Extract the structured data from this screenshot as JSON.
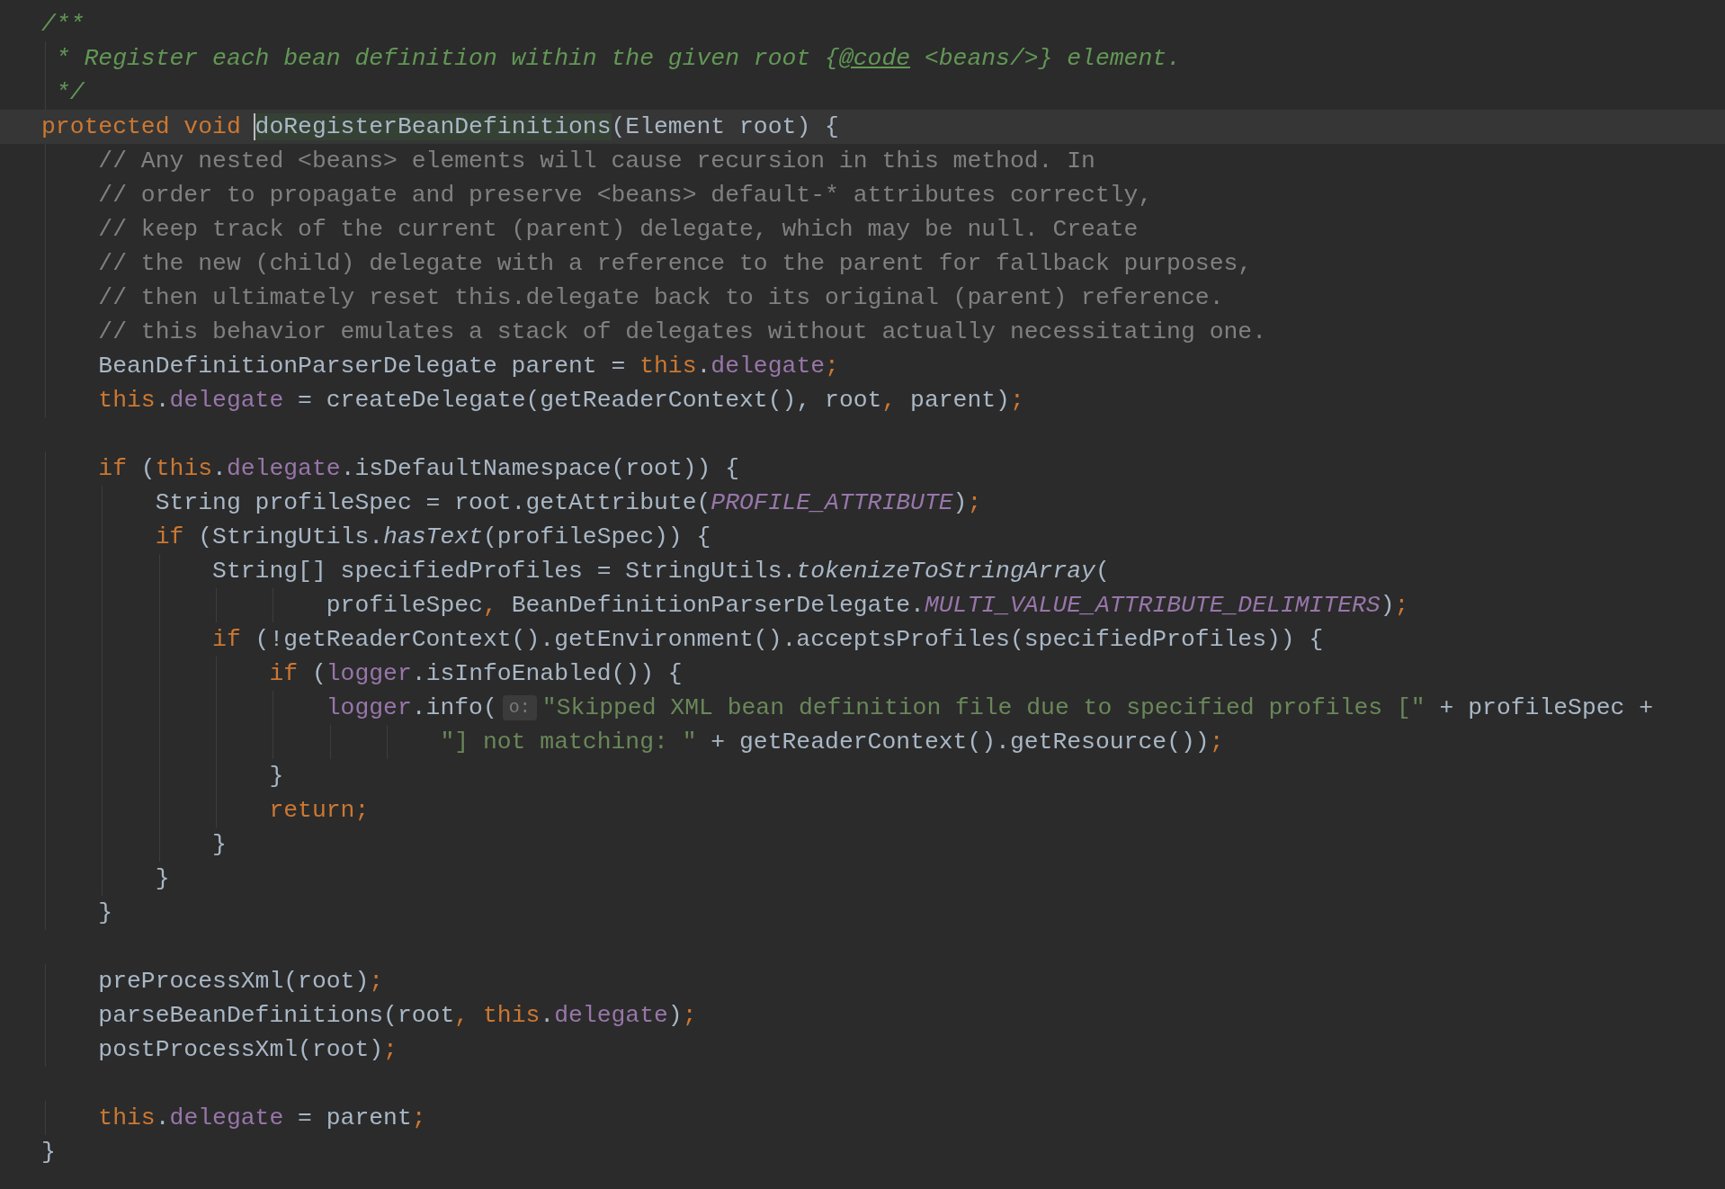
{
  "lines": [
    {
      "current": false,
      "tokens": [
        {
          "kind": "doc",
          "text": "/**"
        }
      ]
    },
    {
      "current": false,
      "tokens": [
        {
          "kind": "doc",
          "text": " * Register each bean definition within the given root {"
        },
        {
          "kind": "doc-tag",
          "text": "@code"
        },
        {
          "kind": "doc",
          "text": " <beans/>} element."
        }
      ]
    },
    {
      "current": false,
      "tokens": [
        {
          "kind": "doc",
          "text": " */"
        }
      ]
    },
    {
      "current": true,
      "tokens": [
        {
          "kind": "keyword",
          "text": "protected void "
        },
        {
          "kind": "usage",
          "text": "doRegisterBeanDefinitions"
        },
        {
          "kind": "plain",
          "text": "(Element root) {"
        }
      ]
    },
    {
      "current": false,
      "tokens": [
        {
          "kind": "comment",
          "text": "    // Any nested <beans> elements will cause recursion in this method. In"
        }
      ]
    },
    {
      "current": false,
      "tokens": [
        {
          "kind": "comment",
          "text": "    // order to propagate and preserve <beans> default-* attributes correctly,"
        }
      ]
    },
    {
      "current": false,
      "tokens": [
        {
          "kind": "comment",
          "text": "    // keep track of the current (parent) delegate, which may be null. Create"
        }
      ]
    },
    {
      "current": false,
      "tokens": [
        {
          "kind": "comment",
          "text": "    // the new (child) delegate with a reference to the parent for fallback purposes,"
        }
      ]
    },
    {
      "current": false,
      "tokens": [
        {
          "kind": "comment",
          "text": "    // then ultimately reset this.delegate back to its original (parent) reference."
        }
      ]
    },
    {
      "current": false,
      "tokens": [
        {
          "kind": "comment",
          "text": "    // this behavior emulates a stack of delegates without actually necessitating one."
        }
      ]
    },
    {
      "current": false,
      "tokens": [
        {
          "kind": "plain",
          "text": "    BeanDefinitionParserDelegate parent = "
        },
        {
          "kind": "keyword",
          "text": "this"
        },
        {
          "kind": "plain",
          "text": "."
        },
        {
          "kind": "field",
          "text": "delegate"
        },
        {
          "kind": "keyword",
          "text": ";"
        }
      ]
    },
    {
      "current": false,
      "tokens": [
        {
          "kind": "keyword",
          "text": "    this"
        },
        {
          "kind": "plain",
          "text": "."
        },
        {
          "kind": "field",
          "text": "delegate"
        },
        {
          "kind": "plain",
          "text": " = createDelegate(getReaderContext(), root"
        },
        {
          "kind": "keyword",
          "text": ","
        },
        {
          "kind": "plain",
          "text": " parent)"
        },
        {
          "kind": "keyword",
          "text": ";"
        }
      ]
    },
    {
      "current": false
    },
    {
      "current": false,
      "tokens": [
        {
          "kind": "keyword",
          "text": "    if"
        },
        {
          "kind": "plain",
          "text": " ("
        },
        {
          "kind": "keyword",
          "text": "this"
        },
        {
          "kind": "plain",
          "text": "."
        },
        {
          "kind": "field",
          "text": "delegate"
        },
        {
          "kind": "plain",
          "text": ".isDefaultNamespace(root)) {"
        }
      ]
    },
    {
      "current": false,
      "tokens": [
        {
          "kind": "plain",
          "text": "        String profileSpec = root.getAttribute("
        },
        {
          "kind": "static",
          "text": "PROFILE_ATTRIBUTE"
        },
        {
          "kind": "plain",
          "text": ")"
        },
        {
          "kind": "keyword",
          "text": ";"
        }
      ]
    },
    {
      "current": false,
      "tokens": [
        {
          "kind": "keyword",
          "text": "        if"
        },
        {
          "kind": "plain",
          "text": " (StringUtils."
        },
        {
          "kind": "method",
          "text": "hasText"
        },
        {
          "kind": "plain",
          "text": "(profileSpec)) {"
        }
      ]
    },
    {
      "current": false,
      "tokens": [
        {
          "kind": "plain",
          "text": "            String[] specifiedProfiles = StringUtils."
        },
        {
          "kind": "method",
          "text": "tokenizeToStringArray"
        },
        {
          "kind": "plain",
          "text": "("
        }
      ]
    },
    {
      "current": false,
      "tokens": [
        {
          "kind": "plain",
          "text": "                    profileSpec"
        },
        {
          "kind": "keyword",
          "text": ","
        },
        {
          "kind": "plain",
          "text": " BeanDefinitionParserDelegate."
        },
        {
          "kind": "static",
          "text": "MULTI_VALUE_ATTRIBUTE_DELIMITERS"
        },
        {
          "kind": "plain",
          "text": ")"
        },
        {
          "kind": "keyword",
          "text": ";"
        }
      ]
    },
    {
      "current": false,
      "tokens": [
        {
          "kind": "keyword",
          "text": "            if"
        },
        {
          "kind": "plain",
          "text": " (!getReaderContext().getEnvironment().acceptsProfiles(specifiedProfiles)) {"
        }
      ]
    },
    {
      "current": false,
      "tokens": [
        {
          "kind": "keyword",
          "text": "                if"
        },
        {
          "kind": "plain",
          "text": " ("
        },
        {
          "kind": "field",
          "text": "logger"
        },
        {
          "kind": "plain",
          "text": ".isInfoEnabled()) {"
        }
      ]
    },
    {
      "current": false,
      "tokens": [
        {
          "kind": "field",
          "text": "                    logger"
        },
        {
          "kind": "plain",
          "text": ".info("
        },
        {
          "kind": "hint",
          "text": "o:"
        },
        {
          "kind": "string",
          "text": "\"Skipped XML bean definition file due to specified profiles [\""
        },
        {
          "kind": "plain",
          "text": " + profileSpec +"
        }
      ]
    },
    {
      "current": false,
      "tokens": [
        {
          "kind": "string",
          "text": "                            \"] not matching: \""
        },
        {
          "kind": "plain",
          "text": " + getReaderContext().getResource())"
        },
        {
          "kind": "keyword",
          "text": ";"
        }
      ]
    },
    {
      "current": false,
      "tokens": [
        {
          "kind": "plain",
          "text": "                }"
        }
      ]
    },
    {
      "current": false,
      "tokens": [
        {
          "kind": "keyword",
          "text": "                return;"
        }
      ]
    },
    {
      "current": false,
      "tokens": [
        {
          "kind": "plain",
          "text": "            }"
        }
      ]
    },
    {
      "current": false,
      "tokens": [
        {
          "kind": "plain",
          "text": "        }"
        }
      ]
    },
    {
      "current": false,
      "tokens": [
        {
          "kind": "plain",
          "text": "    }"
        }
      ]
    },
    {
      "current": false
    },
    {
      "current": false,
      "tokens": [
        {
          "kind": "plain",
          "text": "    preProcessXml(root)"
        },
        {
          "kind": "keyword",
          "text": ";"
        }
      ]
    },
    {
      "current": false,
      "tokens": [
        {
          "kind": "plain",
          "text": "    parseBeanDefinitions(root"
        },
        {
          "kind": "keyword",
          "text": ", this"
        },
        {
          "kind": "plain",
          "text": "."
        },
        {
          "kind": "field",
          "text": "delegate"
        },
        {
          "kind": "plain",
          "text": ")"
        },
        {
          "kind": "keyword",
          "text": ";"
        }
      ]
    },
    {
      "current": false,
      "tokens": [
        {
          "kind": "plain",
          "text": "    postProcessXml(root)"
        },
        {
          "kind": "keyword",
          "text": ";"
        }
      ]
    },
    {
      "current": false
    },
    {
      "current": false,
      "tokens": [
        {
          "kind": "keyword",
          "text": "    this"
        },
        {
          "kind": "plain",
          "text": "."
        },
        {
          "kind": "field",
          "text": "delegate"
        },
        {
          "kind": "plain",
          "text": " = parent"
        },
        {
          "kind": "keyword",
          "text": ";"
        }
      ]
    },
    {
      "current": false,
      "tokens": [
        {
          "kind": "plain",
          "text": "}"
        }
      ]
    }
  ]
}
